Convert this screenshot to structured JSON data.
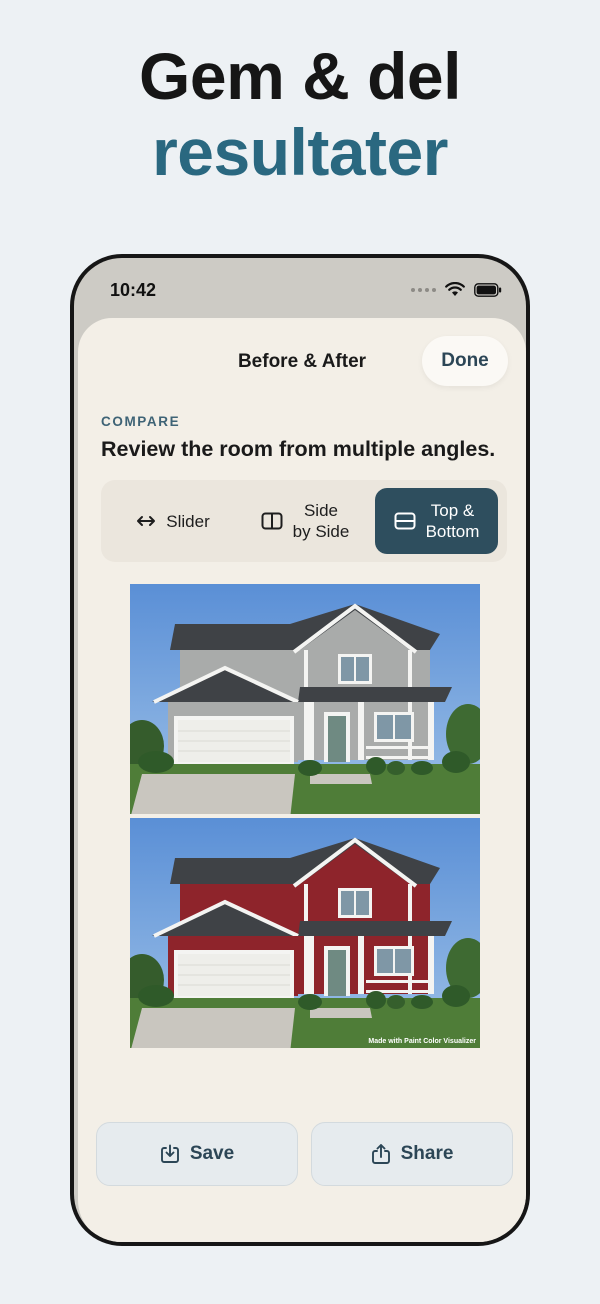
{
  "headline": {
    "line1": "Gem & del",
    "line2": "resultater"
  },
  "status_bar": {
    "time": "10:42"
  },
  "sheet": {
    "title": "Before & After",
    "done_label": "Done",
    "section_label": "COMPARE",
    "section_description": "Review the room from multiple angles."
  },
  "view_modes": [
    {
      "label": "Slider",
      "icon": "arrows-horizontal-icon",
      "selected": false
    },
    {
      "label": "Side\nby Side",
      "icon": "columns-icon",
      "selected": false
    },
    {
      "label": "Top &\nBottom",
      "icon": "rows-icon",
      "selected": true
    }
  ],
  "comparison": {
    "before_siding_color": "#a9abaa",
    "after_siding_color": "#8e242b",
    "watermark": "Made with Paint Color Visualizer"
  },
  "actions": {
    "save_label": "Save",
    "share_label": "Share"
  },
  "colors": {
    "accent": "#2e4e5e",
    "headline_accent": "#2a6880"
  }
}
